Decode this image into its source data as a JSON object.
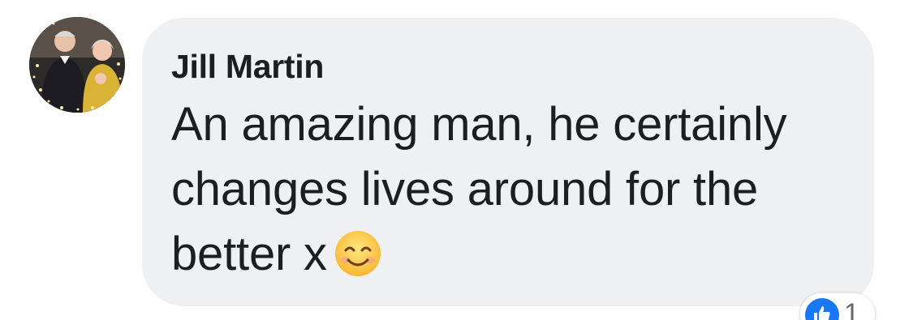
{
  "comment": {
    "author": "Jill Martin",
    "text": "An amazing man, he certainly changes lives around for the better x",
    "emoji": "smiling-face-icon"
  },
  "reaction": {
    "type": "like-icon",
    "count": "1",
    "color": "#1877f2"
  },
  "colors": {
    "bubble": "#eff0f2",
    "text": "#1c1e21"
  }
}
